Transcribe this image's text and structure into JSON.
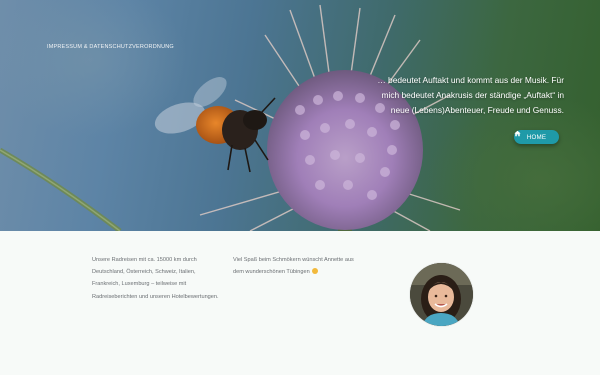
{
  "hero": {
    "nav_link": "IMPRESSUM & DATENSCHUTZVERORDNUNG",
    "tagline_lines": [
      "… bedeutet Auftakt und kommt aus der Musik. Für",
      "mich bedeutet Anakrusis der ständige „Auftakt“ in",
      "neue (Lebens)Abenteuer, Freude und Genuss."
    ],
    "home_button": "HOME",
    "home_icon": "home-icon",
    "image_subject": "bee-on-teasel-flower"
  },
  "content": {
    "col1_lines": [
      "Unsere Radreisen mit ca. 15000 km durch",
      "Deutschland, Österreich, Schweiz, Italien,",
      "Frankreich, Luxemburg – teilweise mit",
      "Radreiseberichten und unseren Hotelbewertungen."
    ],
    "col2_lines": [
      "Viel Spaß beim Schmökern wünscht Annette aus",
      "dem wunderschönen Tübingen"
    ],
    "smiley_icon": "smiley-icon",
    "avatar": "avatar"
  },
  "colors": {
    "accent": "#1f9aa8",
    "body_text": "#6b6f73",
    "content_bg": "#f7faf8"
  }
}
